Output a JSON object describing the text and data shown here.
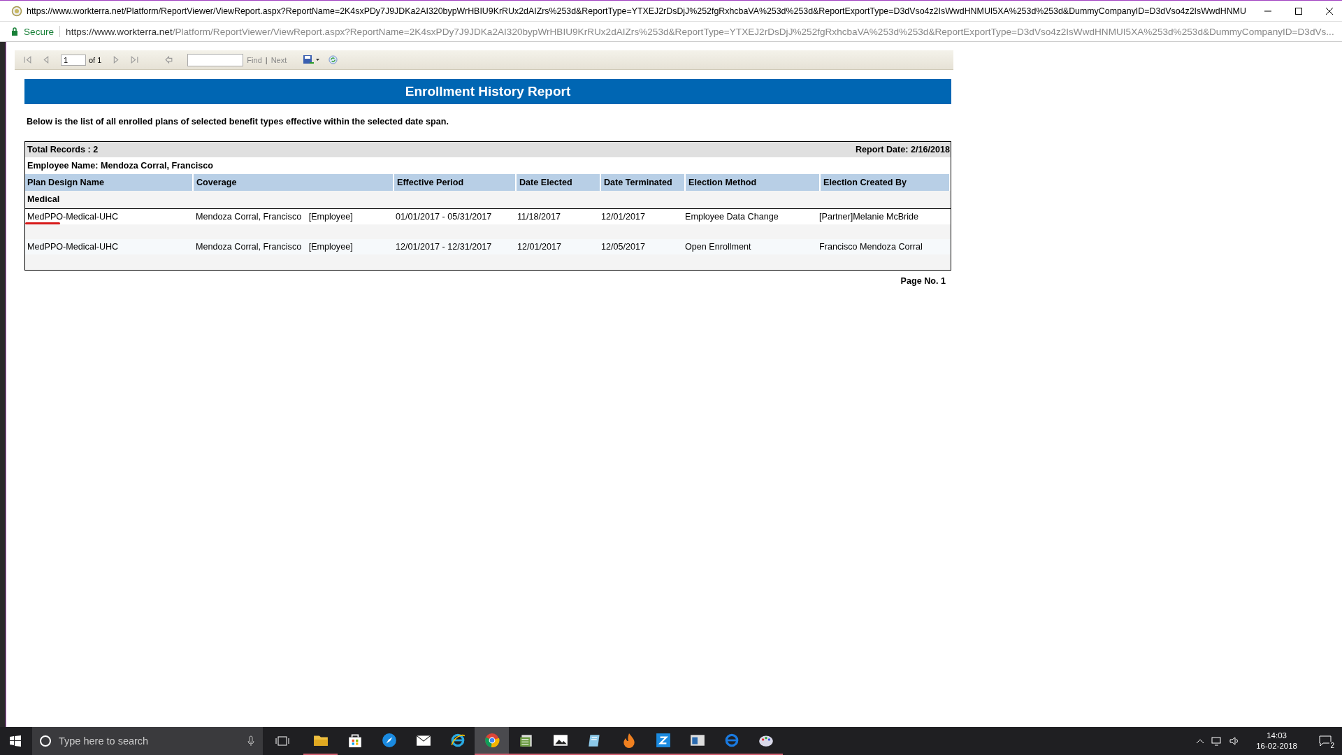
{
  "window": {
    "title": "https://www.workterra.net/Platform/ReportViewer/ViewReport.aspx?ReportName=2K4sxPDy7J9JDKa2AI320bypWrHBIU9KrRUx2dAIZrs%253d&ReportType=YTXEJ2rDsDjJ%252fgRxhcbaVA%253d%253d&ReportExportType=D3dVso4z2IsWwdHNMUI5XA%253d%253d&DummyCompanyID=D3dVso4z2IsWwdHNMU"
  },
  "address_bar": {
    "secure_label": "Secure",
    "url_host": "https://www.workterra.net",
    "url_path": "/Platform/ReportViewer/ViewReport.aspx?ReportName=2K4sxPDy7J9JDKa2AI320bypWrHBIU9KrRUx2dAIZrs%253d&ReportType=YTXEJ2rDsDjJ%252fgRxhcbaVA%253d%253d&ReportExportType=D3dVso4z2IsWwdHNMUI5XA%253d%253d&DummyCompanyID=D3dVs..."
  },
  "toolbar": {
    "page": "1",
    "page_of": "of 1",
    "find": "Find",
    "separator": "|",
    "next": "Next"
  },
  "report": {
    "title": "Enrollment History Report",
    "description": "Below is the list of all enrolled plans of selected benefit types effective within the selected date span.",
    "total_records": "Total Records : 2",
    "report_date": "Report Date: 2/16/2018",
    "employee": "Employee Name: Mendoza Corral, Francisco",
    "columns": [
      "Plan Design Name",
      "Coverage",
      "Effective Period",
      "Date Elected",
      "Date Terminated",
      "Election Method",
      "Election Created By"
    ],
    "group": "Medical",
    "rows": [
      {
        "cells": [
          "MedPPO-Medical-UHC",
          "Mendoza Corral, Francisco   [Employee]",
          "01/01/2017 - 05/31/2017",
          "11/18/2017",
          "12/01/2017",
          "Employee Data Change",
          "[Partner]Melanie McBride"
        ],
        "marked": true
      },
      {
        "cells": [
          "MedPPO-Medical-UHC",
          "Mendoza Corral, Francisco   [Employee]",
          "12/01/2017 - 12/31/2017",
          "12/01/2017",
          "12/05/2017",
          "Open Enrollment",
          "Francisco Mendoza Corral"
        ],
        "marked": false
      }
    ],
    "page_no": "Page No. 1"
  },
  "taskbar": {
    "search_placeholder": "Type here to search",
    "apps": [
      {
        "kind": "folder",
        "running": true,
        "selected": false
      },
      {
        "kind": "bag",
        "running": false,
        "selected": false
      },
      {
        "kind": "compass",
        "running": false,
        "selected": false
      },
      {
        "kind": "envelope",
        "running": false,
        "selected": false
      },
      {
        "kind": "e-logo",
        "running": false,
        "selected": false
      },
      {
        "kind": "chrome",
        "running": true,
        "selected": true
      },
      {
        "kind": "stack",
        "running": true,
        "selected": false
      },
      {
        "kind": "image",
        "running": true,
        "selected": false
      },
      {
        "kind": "book",
        "running": true,
        "selected": false
      },
      {
        "kind": "flame",
        "running": true,
        "selected": false
      },
      {
        "kind": "z-tile",
        "running": true,
        "selected": false
      },
      {
        "kind": "window",
        "running": true,
        "selected": false
      },
      {
        "kind": "e-blue",
        "running": true,
        "selected": false
      },
      {
        "kind": "palette",
        "running": true,
        "selected": false
      }
    ],
    "time": "14:03",
    "date": "16-02-2018",
    "notifications": "2"
  }
}
